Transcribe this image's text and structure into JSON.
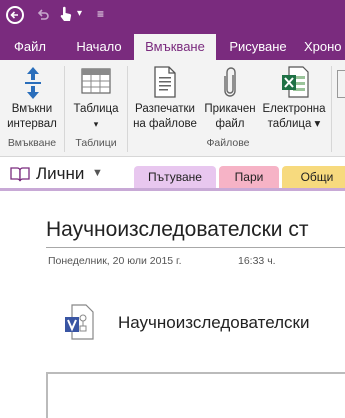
{
  "qat": {
    "undo_icon": "undo-icon",
    "touch_icon": "touch-mode-icon",
    "dropdown": "▾",
    "customize": "≡"
  },
  "tabs": [
    {
      "label": "Файл"
    },
    {
      "label": "Начало"
    },
    {
      "label": "Вмъкване",
      "active": true
    },
    {
      "label": "Рисуване"
    },
    {
      "label": "Хроно"
    }
  ],
  "ribbon": {
    "insert_space": {
      "line1": "Вмъкни",
      "line2": "интервал"
    },
    "table": {
      "label": "Таблица",
      "arrow": "▾"
    },
    "printout": {
      "line1": "Разпечатки",
      "line2": "на файлове"
    },
    "attach": {
      "line1": "Прикачен",
      "line2": "файл"
    },
    "spreadsheet": {
      "line1": "Електронна",
      "line2": "таблица ▾"
    },
    "groups": {
      "insert": "Вмъкване",
      "tables": "Таблици",
      "files": "Файлове"
    }
  },
  "notebook": {
    "name": "Лични",
    "arrow": "▼"
  },
  "sections": [
    {
      "label": "Пътуване",
      "color": "#e8c7ef"
    },
    {
      "label": "Пари",
      "color": "#f6b3c6"
    },
    {
      "label": "Общи",
      "color": "#f7da7e"
    }
  ],
  "page": {
    "title": "Научноизследователски ст",
    "date": "Понеделник, 20 юли 2015 г.",
    "time": "16:33 ч.",
    "attachment_name": "Научноизследователски"
  },
  "colors": {
    "accent": "#7a2b7e",
    "ribbon_bg": "#f3f3f3"
  }
}
